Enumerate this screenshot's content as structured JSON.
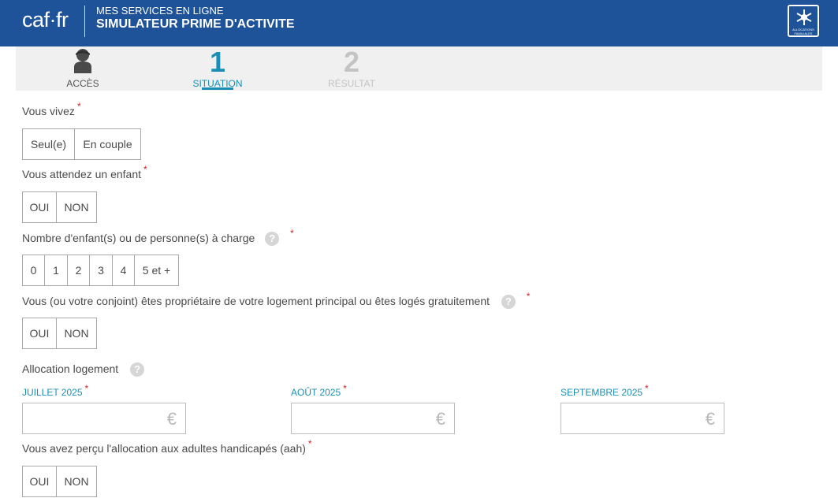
{
  "header": {
    "logo": "caf·fr",
    "subtitle": "MES SERVICES EN LIGNE",
    "title": "SIMULATEUR PRIME D'ACTIVITE",
    "badge_text": "ALLOCATIONS FAMILIALES"
  },
  "steps": {
    "acces": {
      "label": "ACCÈS"
    },
    "situation": {
      "number": "1",
      "label": "SITUATION"
    },
    "resultat": {
      "number": "2",
      "label": "RÉSULTAT"
    }
  },
  "form": {
    "required_mark": "*",
    "help_glyph": "?",
    "vous_vivez": {
      "label": "Vous vivez",
      "options": [
        "Seul(e)",
        "En couple"
      ]
    },
    "enfant_attendu": {
      "label": "Vous attendez un enfant",
      "options": [
        "OUI",
        "NON"
      ]
    },
    "nombre_enfants": {
      "label": "Nombre d'enfant(s) ou de personne(s) à charge",
      "options": [
        "0",
        "1",
        "2",
        "3",
        "4",
        "5 et +"
      ]
    },
    "proprietaire": {
      "label": "Vous (ou votre conjoint) êtes propriétaire de votre logement principal ou êtes logés gratuitement",
      "options": [
        "OUI",
        "NON"
      ]
    },
    "allocation_logement": {
      "label": "Allocation logement",
      "months": [
        {
          "label": "JUILLET 2025",
          "value": "",
          "currency": "€"
        },
        {
          "label": "AOÛT 2025",
          "value": "",
          "currency": "€"
        },
        {
          "label": "SEPTEMBRE 2025",
          "value": "",
          "currency": "€"
        }
      ]
    },
    "aah": {
      "label": "Vous avez perçu l'allocation aux adultes handicapés (aah)",
      "options": [
        "OUI",
        "NON"
      ]
    }
  }
}
